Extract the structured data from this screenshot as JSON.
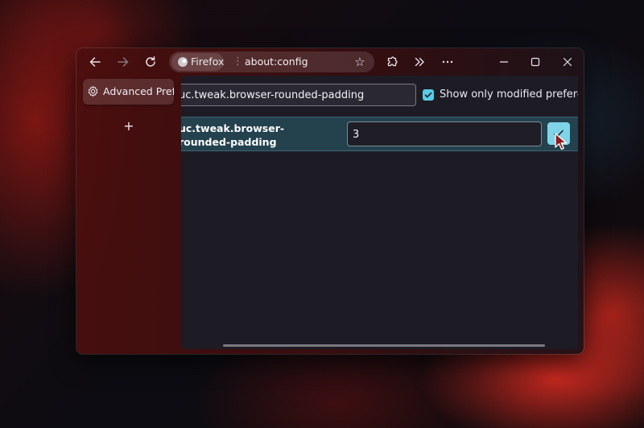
{
  "browser": {
    "identity_label": "Firefox",
    "url": "about:config"
  },
  "sidebar": {
    "tab_label": "Advanced Preferences",
    "new_tab_glyph": "+"
  },
  "config": {
    "search_value": "uc.tweak.browser-rounded-padding",
    "show_modified_label": "Show only modified preferences",
    "show_modified_checked": true,
    "pref_name": "uc.tweak.browser-rounded-padding",
    "pref_value": "3"
  },
  "icons": {
    "back": "back-arrow-icon",
    "forward": "forward-arrow-icon",
    "reload": "reload-icon",
    "firefox": "firefox-logo-icon",
    "bookmark": "star-icon",
    "extensions": "puzzle-icon",
    "overflow": "chevrons-right-icon",
    "menu": "more-dots-icon",
    "settings": "gear-icon",
    "save": "checkmark-icon"
  },
  "colors": {
    "accent": "#58cce6",
    "save_button": "#7fd4e8",
    "row_highlight": "#24414e",
    "content_bg": "#1d1b24"
  }
}
